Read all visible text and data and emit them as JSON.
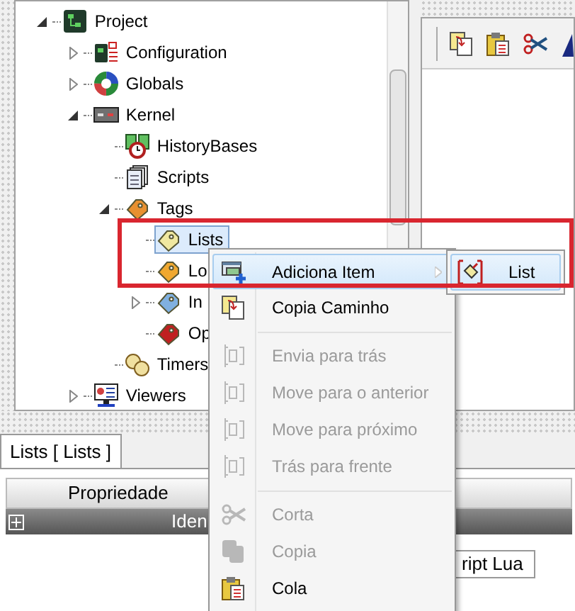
{
  "tree": [
    {
      "label": "Project",
      "kind": "project",
      "expandable": true,
      "expanded": true,
      "selected": false,
      "children": [
        {
          "label": "Configuration",
          "kind": "config",
          "expandable": true,
          "expanded": false,
          "selected": false
        },
        {
          "label": "Globals",
          "kind": "globals",
          "expandable": true,
          "expanded": false,
          "selected": false
        },
        {
          "label": "Kernel",
          "kind": "kernel",
          "expandable": true,
          "expanded": true,
          "selected": false,
          "children": [
            {
              "label": "HistoryBases",
              "kind": "history",
              "expandable": false,
              "expanded": false,
              "selected": false
            },
            {
              "label": "Scripts",
              "kind": "scripts",
              "expandable": false,
              "expanded": false,
              "selected": false
            },
            {
              "label": "Tags",
              "kind": "tag",
              "expandable": true,
              "expanded": true,
              "selected": false,
              "children": [
                {
                  "label": "Lists",
                  "kind": "lists",
                  "expandable": false,
                  "expanded": false,
                  "selected": true
                },
                {
                  "label": "Lo",
                  "kind": "local",
                  "expandable": false,
                  "expanded": false,
                  "selected": false
                },
                {
                  "label": "In",
                  "kind": "internal",
                  "expandable": true,
                  "expanded": false,
                  "selected": false
                },
                {
                  "label": "Op",
                  "kind": "opc",
                  "expandable": false,
                  "expanded": false,
                  "selected": false
                }
              ]
            },
            {
              "label": "Timers",
              "kind": "timers",
              "expandable": false,
              "expanded": false,
              "selected": false
            }
          ]
        },
        {
          "label": "Viewers",
          "kind": "viewers",
          "expandable": true,
          "expanded": false,
          "selected": false
        }
      ]
    }
  ],
  "bottom": {
    "tabs": [
      {
        "label": "Lists [ Lists ]",
        "selected": true
      }
    ],
    "column": "Propriedade",
    "row": {
      "label": "Iden",
      "expanded": false
    },
    "second_tab": "ript Lua"
  },
  "menu": {
    "groups": [
      [
        {
          "label": "Adiciona Item",
          "kind": "add",
          "disabled": false,
          "selected": true,
          "submenu": [
            {
              "label": "List",
              "kind": "list",
              "selected": true
            }
          ]
        },
        {
          "label": "Copia Caminho",
          "kind": "copypath",
          "disabled": false,
          "selected": false
        }
      ],
      [
        {
          "label": "Envia para trás",
          "kind": "back",
          "disabled": true,
          "selected": false
        },
        {
          "label": "Move para o anterior",
          "kind": "prev",
          "disabled": true,
          "selected": false
        },
        {
          "label": "Move para próximo",
          "kind": "next",
          "disabled": true,
          "selected": false
        },
        {
          "label": "Trás para frente",
          "kind": "front",
          "disabled": true,
          "selected": false
        }
      ],
      [
        {
          "label": "Corta",
          "kind": "cut",
          "disabled": true,
          "selected": false
        },
        {
          "label": "Copia",
          "kind": "copy",
          "disabled": true,
          "selected": false
        },
        {
          "label": "Cola",
          "kind": "paste",
          "disabled": false,
          "selected": false
        }
      ]
    ]
  }
}
